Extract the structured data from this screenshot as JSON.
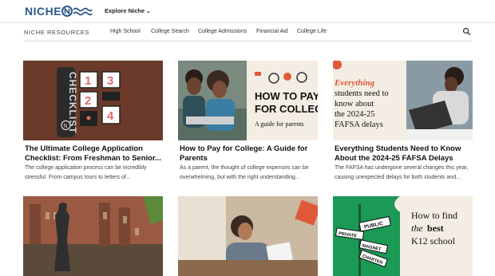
{
  "header": {
    "logo_text": "NICHE",
    "explore_label": "Explore Niche"
  },
  "subnav": {
    "title": "NICHE RESOURCES",
    "items": [
      "High School",
      "College Search",
      "College Admissions",
      "Financial Aid",
      "College Life"
    ]
  },
  "cards": [
    {
      "title": "The Ultimate College Application Checklist: From Freshman to Senior...",
      "description": "The college application process can be incredibly stressful. From campus tours to letters of...",
      "image": {
        "vertical_text": "CHECKLIST",
        "numbers": [
          "1",
          "3",
          "2",
          "4"
        ]
      }
    },
    {
      "title": "How to Pay for College: A Guide for Parents",
      "description": "As a parent, the thought of college expenses can be overwhelming, but with the right understanding...",
      "image": {
        "headline": "HOW TO PAY FOR COLLEGE",
        "subhead": "A guide for parents"
      }
    },
    {
      "title": "Everything Students Need to Know About the 2024-25 FAFSA Delays",
      "description": "The FAFSA has undergone several changes this year, causing unexpected delays for both students and...",
      "image": {
        "kicker": "Everything",
        "headline": "students need to know about the 2024-25 FAFSA delays"
      }
    },
    {
      "title": "",
      "description": "",
      "image": {}
    },
    {
      "title": "",
      "description": "",
      "image": {}
    },
    {
      "title": "",
      "description": "",
      "image": {
        "headline_a": "How to find",
        "headline_b": "the",
        "headline_c": "best",
        "headline_d": "K12 school",
        "signs": [
          "PUBLIC",
          "PRIVATE",
          "MAGNET",
          "CHARTER"
        ]
      }
    }
  ],
  "colors": {
    "brand": "#2b5a8c",
    "teal": "#4fb79b",
    "brown": "#6b3a2a",
    "green": "#1a9a55",
    "cream": "#f4ede3"
  }
}
